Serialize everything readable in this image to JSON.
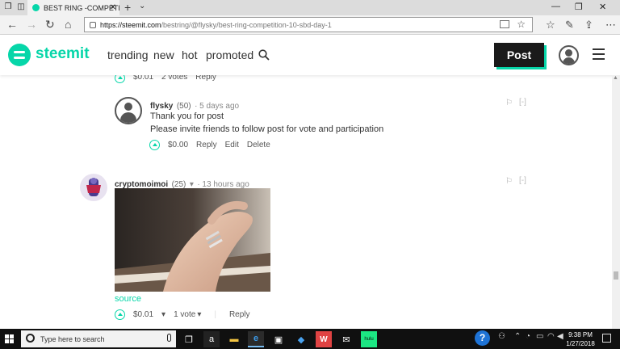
{
  "browser": {
    "tab_title": "BEST RING -COMPETITI",
    "tab_close": "✕",
    "new_tab": "+",
    "tab_list": "⌄",
    "url_host": "https://steemit.com",
    "url_path": "/bestring/@flysky/best-ring-competition-10-sbd-day-1",
    "minimize": "—",
    "restore": "❐",
    "close": "✕",
    "back": "←",
    "forward": "→",
    "refresh": "↻",
    "home": "⌂",
    "favorite": "☆",
    "hub": "☆",
    "notes": "✎",
    "share": "⇪",
    "more": "⋯"
  },
  "header": {
    "brand": "steemit",
    "nav": [
      "trending",
      "new",
      "hot",
      "promoted"
    ],
    "post_label": "Post",
    "accent": "#06d6a9"
  },
  "previous_comment": {
    "payout": "$0.01",
    "votes": "2 votes",
    "reply": "Reply"
  },
  "comments": [
    {
      "author": "flysky",
      "reputation": "(50)",
      "time": "5 days ago",
      "lines": [
        "Thank you for post",
        "Please invite friends to follow post for vote and participation"
      ],
      "payout": "$0.00",
      "reply": "Reply",
      "edit": "Edit",
      "delete": "Delete",
      "flag_icon": "flag-icon",
      "collapse": "[-]"
    },
    {
      "author": "cryptomoimoi",
      "reputation": "(25)",
      "time": "13 hours ago",
      "source_link": "source",
      "payout": "$0.01",
      "votes": "1 vote",
      "reply": "Reply",
      "flag_icon": "flag-icon",
      "collapse": "[-]"
    }
  ],
  "taskbar": {
    "search_placeholder": "Type here to search",
    "time": "9:38 PM",
    "date": "1/27/2018",
    "apps": [
      "task-view",
      "amazon",
      "file-explorer",
      "edge",
      "store",
      "dropbox",
      "wps",
      "mail",
      "hulu"
    ]
  }
}
